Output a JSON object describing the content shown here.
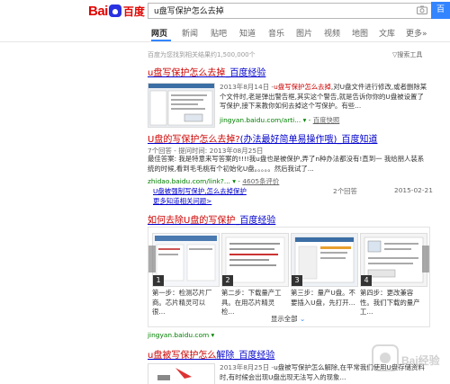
{
  "header": {
    "logo_text_bai": "Bai",
    "logo_text_du": "du",
    "logo_text_cn": "百度",
    "search_value": "u盘写保护怎么去掉",
    "search_button": "百"
  },
  "tabs": [
    "网页",
    "新闻",
    "贴吧",
    "知道",
    "音乐",
    "图片",
    "视频",
    "地图",
    "文库",
    "更多»"
  ],
  "summary": {
    "result_count": "百度为您找到相关结果约1,500,000个",
    "tools": "搜索工具"
  },
  "results": [
    {
      "title_a": "u盘写保护怎么去掉",
      "title_b": "_百度经验",
      "date": "2013年8月14日 -",
      "snippet_1": "u盘写保护怎么去掉",
      "snippet_2": ",对U盘文件进行修改,或者删除某个文件时,老是弹出警告框,其实这个警告,就是告诉你你的U盘被设置了写保护,接下来教你如何去掉这个写保护。有些...",
      "url": "jingyan.baidu.com/arti... ▾ - ",
      "cache": "百度快照"
    },
    {
      "title_a": "U盘的写保护怎么去掉?",
      "title_b": "(办法最好简单易操作哦)_百度知道",
      "meta": "7个回答 - 提问时间: 2013年08月25日",
      "snippet": "最佳答案: 我是特意来写答案的!!!!我u盘也是被保护,弄了n种办法都没有!直到一 我给朋人装系统的时候,看到毛毛桃有个初始化U盘。。。。。然后我试了...",
      "url": "zhidao.baidu.com/link?... ▾ - ",
      "eval": "4605条评价",
      "sub_link": "U盘被强制写保护,怎么去掉保护",
      "sub_answers": "2个回答",
      "sub_date": "2015-02-21",
      "more_link": "更多知道相关问题>"
    },
    {
      "title_a": "如何去除U盘的写保护",
      "title_b": "_百度经验",
      "steps": [
        {
          "num": "1",
          "text": "第一步：检测芯片厂商。芯片精灵可以很..."
        },
        {
          "num": "2",
          "text": "第二步：下载量产工具。在用芯片精灵检..."
        },
        {
          "num": "3",
          "text": "第三步：量产U盘。不要插入U盘，先打开..."
        },
        {
          "num": "4",
          "text": "第四步：更改兼容性。我们下载的量产工..."
        }
      ],
      "show_all": "显示全部",
      "url": "jingyan.baidu.com ▾"
    },
    {
      "title_a": "u盘被写保护怎么",
      "title_b": "解除_百度经验",
      "date": "2013年8月25日 -",
      "snippet": "u盘被写保护怎么解除,在平常我们使用U盘存储资料时,有时候会出现U盘出现无法写入的现象..."
    }
  ],
  "watermark": "Bai经验"
}
